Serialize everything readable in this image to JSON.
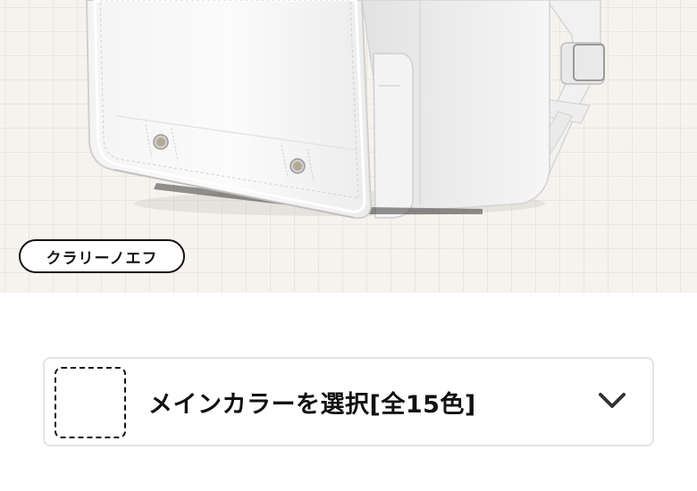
{
  "product": {
    "model_name": "クラリーノエフ"
  },
  "color_selector": {
    "label": "メインカラーを選択[全15色]",
    "selected_color": "none"
  },
  "icons": {
    "dropdown": "chevron-down-icon"
  }
}
